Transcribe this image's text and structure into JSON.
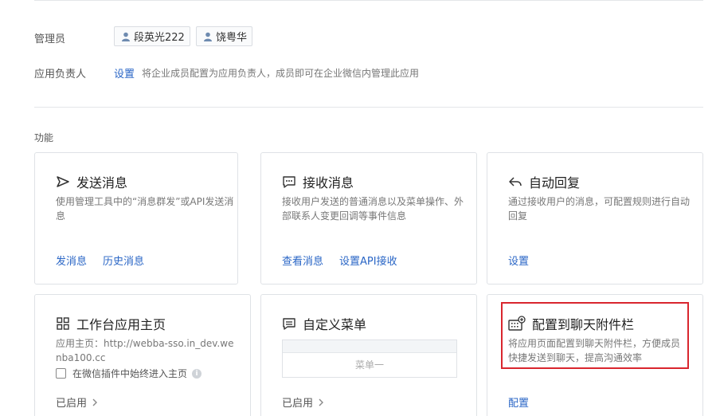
{
  "admin": {
    "label": "管理员",
    "members": [
      "段英光222",
      "饶粤华"
    ]
  },
  "owner": {
    "label": "应用负责人",
    "link": "设置",
    "description": "将企业成员配置为应用负责人，成员即可在企业微信内管理此应用"
  },
  "features": {
    "section_label": "功能",
    "send": {
      "title": "发送消息",
      "icon": "send-icon",
      "desc": "使用管理工具中的“消息群发”或API发送消息",
      "actions": [
        "发消息",
        "历史消息"
      ]
    },
    "receive": {
      "title": "接收消息",
      "icon": "chat-icon",
      "desc": "接收用户发送的普通消息以及菜单操作、外部联系人变更回调等事件信息",
      "actions": [
        "查看消息",
        "设置API接收"
      ]
    },
    "autoreply": {
      "title": "自动回复",
      "icon": "reply-icon",
      "desc": "通过接收用户的消息，可配置规则进行自动回复",
      "actions": [
        "设置"
      ]
    },
    "workbench": {
      "title": "工作台应用主页",
      "icon": "grid-icon",
      "desc": "应用主页：http://webba-sso.in_dev.wenba100.cc",
      "checkbox_label": "在微信插件中始终进入主页",
      "status": "已启用"
    },
    "custom_menu": {
      "title": "自定义菜单",
      "icon": "menu-icon",
      "menu_item": "菜单一",
      "status": "已启用"
    },
    "chat_attachment": {
      "title": "配置到聊天附件栏",
      "icon": "keyboard-plus-icon",
      "desc": "将应用页面配置到聊天附件栏，方便成员快捷发送到聊天，提高沟通效率",
      "action": "配置"
    }
  },
  "colors": {
    "link": "#2a66c6",
    "highlight": "#d9262e"
  }
}
